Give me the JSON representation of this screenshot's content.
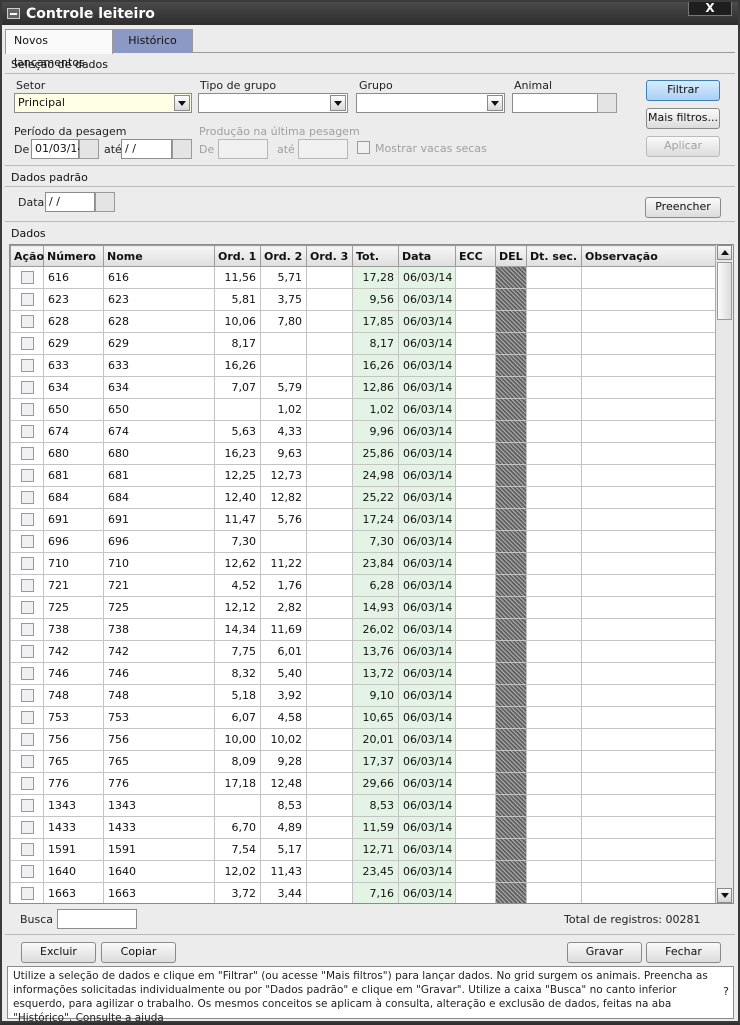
{
  "window": {
    "title": "Controle leiteiro",
    "close_label": "X"
  },
  "tabs": [
    {
      "label": "Novos lançamentos",
      "active": true
    },
    {
      "label": "Histórico",
      "active": false
    }
  ],
  "selection": {
    "section_label": "Seleção de dados",
    "setor_label": "Setor",
    "setor_value": "Principal",
    "tipo_grupo_label": "Tipo de grupo",
    "tipo_grupo_value": "",
    "grupo_label": "Grupo",
    "grupo_value": "",
    "animal_label": "Animal",
    "animal_value": "",
    "periodo_label": "Período da pesagem",
    "de_label": "De",
    "de_value": "01/03/14",
    "ate_label": "até",
    "ate_value": " / /",
    "producao_label": "Produção na última pesagem",
    "prod_de_label": "De",
    "prod_ate_label": "até",
    "mostrar_secas_label": "Mostrar vacas secas",
    "filtrar_label": "Filtrar",
    "mais_filtros_label": "Mais filtros...",
    "aplicar_label": "Aplicar"
  },
  "padrao": {
    "section_label": "Dados padrão",
    "data_label": "Data",
    "data_value": " / /",
    "preencher_label": "Preencher"
  },
  "grid": {
    "section_label": "Dados",
    "columns": [
      "Ação",
      "Número",
      "Nome",
      "Ord. 1",
      "Ord. 2",
      "Ord. 3",
      "Tot.",
      "Data",
      "ECC",
      "DEL",
      "Dt. sec.",
      "Observação"
    ],
    "rows": [
      {
        "numero": "616",
        "nome": "616",
        "ord1": "11,56",
        "ord2": "5,71",
        "ord3": "",
        "tot": "17,28",
        "data": "06/03/14"
      },
      {
        "numero": "623",
        "nome": "623",
        "ord1": "5,81",
        "ord2": "3,75",
        "ord3": "",
        "tot": "9,56",
        "data": "06/03/14"
      },
      {
        "numero": "628",
        "nome": "628",
        "ord1": "10,06",
        "ord2": "7,80",
        "ord3": "",
        "tot": "17,85",
        "data": "06/03/14"
      },
      {
        "numero": "629",
        "nome": "629",
        "ord1": "8,17",
        "ord2": "",
        "ord3": "",
        "tot": "8,17",
        "data": "06/03/14"
      },
      {
        "numero": "633",
        "nome": "633",
        "ord1": "16,26",
        "ord2": "",
        "ord3": "",
        "tot": "16,26",
        "data": "06/03/14"
      },
      {
        "numero": "634",
        "nome": "634",
        "ord1": "7,07",
        "ord2": "5,79",
        "ord3": "",
        "tot": "12,86",
        "data": "06/03/14"
      },
      {
        "numero": "650",
        "nome": "650",
        "ord1": "",
        "ord2": "1,02",
        "ord3": "",
        "tot": "1,02",
        "data": "06/03/14"
      },
      {
        "numero": "674",
        "nome": "674",
        "ord1": "5,63",
        "ord2": "4,33",
        "ord3": "",
        "tot": "9,96",
        "data": "06/03/14"
      },
      {
        "numero": "680",
        "nome": "680",
        "ord1": "16,23",
        "ord2": "9,63",
        "ord3": "",
        "tot": "25,86",
        "data": "06/03/14"
      },
      {
        "numero": "681",
        "nome": "681",
        "ord1": "12,25",
        "ord2": "12,73",
        "ord3": "",
        "tot": "24,98",
        "data": "06/03/14"
      },
      {
        "numero": "684",
        "nome": "684",
        "ord1": "12,40",
        "ord2": "12,82",
        "ord3": "",
        "tot": "25,22",
        "data": "06/03/14"
      },
      {
        "numero": "691",
        "nome": "691",
        "ord1": "11,47",
        "ord2": "5,76",
        "ord3": "",
        "tot": "17,24",
        "data": "06/03/14"
      },
      {
        "numero": "696",
        "nome": "696",
        "ord1": "7,30",
        "ord2": "",
        "ord3": "",
        "tot": "7,30",
        "data": "06/03/14"
      },
      {
        "numero": "710",
        "nome": "710",
        "ord1": "12,62",
        "ord2": "11,22",
        "ord3": "",
        "tot": "23,84",
        "data": "06/03/14"
      },
      {
        "numero": "721",
        "nome": "721",
        "ord1": "4,52",
        "ord2": "1,76",
        "ord3": "",
        "tot": "6,28",
        "data": "06/03/14"
      },
      {
        "numero": "725",
        "nome": "725",
        "ord1": "12,12",
        "ord2": "2,82",
        "ord3": "",
        "tot": "14,93",
        "data": "06/03/14"
      },
      {
        "numero": "738",
        "nome": "738",
        "ord1": "14,34",
        "ord2": "11,69",
        "ord3": "",
        "tot": "26,02",
        "data": "06/03/14"
      },
      {
        "numero": "742",
        "nome": "742",
        "ord1": "7,75",
        "ord2": "6,01",
        "ord3": "",
        "tot": "13,76",
        "data": "06/03/14"
      },
      {
        "numero": "746",
        "nome": "746",
        "ord1": "8,32",
        "ord2": "5,40",
        "ord3": "",
        "tot": "13,72",
        "data": "06/03/14"
      },
      {
        "numero": "748",
        "nome": "748",
        "ord1": "5,18",
        "ord2": "3,92",
        "ord3": "",
        "tot": "9,10",
        "data": "06/03/14"
      },
      {
        "numero": "753",
        "nome": "753",
        "ord1": "6,07",
        "ord2": "4,58",
        "ord3": "",
        "tot": "10,65",
        "data": "06/03/14"
      },
      {
        "numero": "756",
        "nome": "756",
        "ord1": "10,00",
        "ord2": "10,02",
        "ord3": "",
        "tot": "20,01",
        "data": "06/03/14"
      },
      {
        "numero": "765",
        "nome": "765",
        "ord1": "8,09",
        "ord2": "9,28",
        "ord3": "",
        "tot": "17,37",
        "data": "06/03/14"
      },
      {
        "numero": "776",
        "nome": "776",
        "ord1": "17,18",
        "ord2": "12,48",
        "ord3": "",
        "tot": "29,66",
        "data": "06/03/14"
      },
      {
        "numero": "1343",
        "nome": "1343",
        "ord1": "",
        "ord2": "8,53",
        "ord3": "",
        "tot": "8,53",
        "data": "06/03/14"
      },
      {
        "numero": "1433",
        "nome": "1433",
        "ord1": "6,70",
        "ord2": "4,89",
        "ord3": "",
        "tot": "11,59",
        "data": "06/03/14"
      },
      {
        "numero": "1591",
        "nome": "1591",
        "ord1": "7,54",
        "ord2": "5,17",
        "ord3": "",
        "tot": "12,71",
        "data": "06/03/14"
      },
      {
        "numero": "1640",
        "nome": "1640",
        "ord1": "12,02",
        "ord2": "11,43",
        "ord3": "",
        "tot": "23,45",
        "data": "06/03/14"
      },
      {
        "numero": "1663",
        "nome": "1663",
        "ord1": "3,72",
        "ord2": "3,44",
        "ord3": "",
        "tot": "7,16",
        "data": "06/03/14"
      }
    ]
  },
  "footer": {
    "busca_label": "Busca",
    "busca_value": "",
    "total_label": "Total de registros: 00281",
    "excluir_label": "Excluir",
    "copiar_label": "Copiar",
    "gravar_label": "Gravar",
    "fechar_label": "Fechar"
  },
  "help": {
    "text": "Utilize a seleção de dados e clique em \"Filtrar\" (ou acesse \"Mais filtros\") para lançar dados. No grid surgem os animais. Preencha as informações solicitadas individualmente ou por \"Dados padrão\" e clique em  \"Gravar\". Utilize a caixa \"Busca\" no canto inferior esquerdo, para agilizar o trabalho. Os mesmos conceitos se aplicam à consulta, alteração e exclusão de dados, feitas na aba \"Histórico\". Consulte a ajuda",
    "question_mark": "?"
  },
  "colors": {
    "titlebar": "#2d2d2d",
    "tab_inactive": "#8c99c4",
    "total_column": "#e4f4e4",
    "filter_button": "#a9d0f5"
  }
}
